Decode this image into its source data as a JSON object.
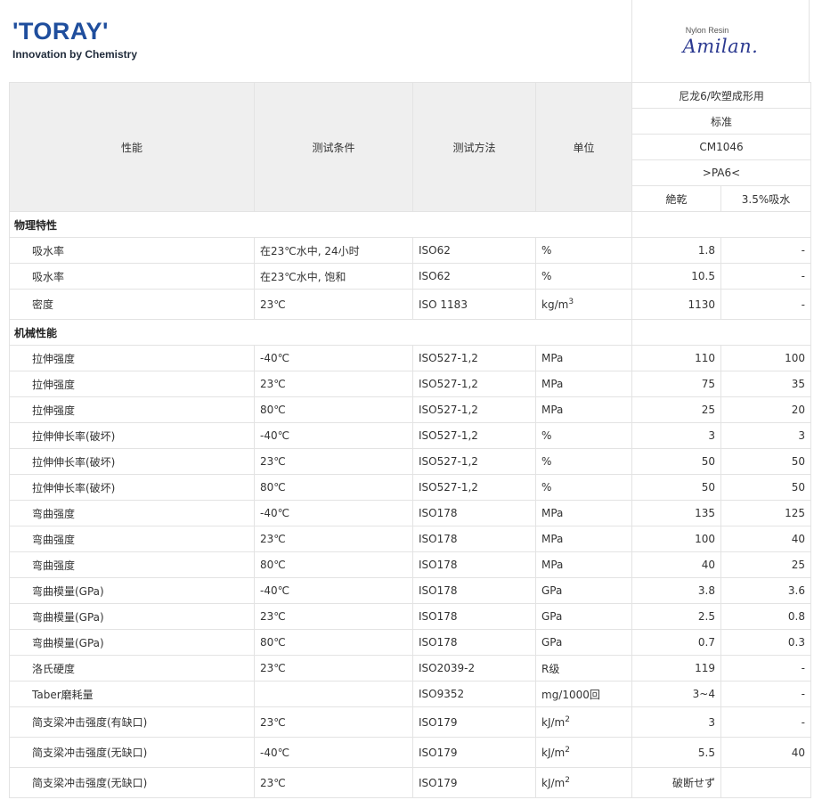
{
  "header": {
    "logo_text": "'TORAY'",
    "tagline": "Innovation by Chemistry",
    "brand_sub": "Nylon Resin",
    "brand_name": "Amilan."
  },
  "table": {
    "columns": {
      "property": "性能",
      "condition": "测试条件",
      "method": "测试方法",
      "unit": "单位"
    },
    "product": {
      "category": "尼龙6/吹塑成形用",
      "grade": "标准",
      "model": "CM1046",
      "marking": ">PA6<",
      "col_dry": "絶乾",
      "col_wet": "3.5%吸水"
    },
    "sections": [
      {
        "title": "物理特性",
        "rows": [
          {
            "prop": "吸水率",
            "cond": "在23℃水中, 24小时",
            "method": "ISO62",
            "unit": "%",
            "dry": "1.8",
            "wet": "-"
          },
          {
            "prop": "吸水率",
            "cond": "在23℃水中, 饱和",
            "method": "ISO62",
            "unit": "%",
            "dry": "10.5",
            "wet": "-"
          },
          {
            "prop": "密度",
            "cond": "23℃",
            "method": "ISO 1183",
            "unit": "kg/m",
            "unit_sup": "3",
            "dry": "1130",
            "wet": "-"
          }
        ]
      },
      {
        "title": "机械性能",
        "rows": [
          {
            "prop": "拉伸强度",
            "cond": "-40℃",
            "method": "ISO527-1,2",
            "unit": "MPa",
            "dry": "110",
            "wet": "100"
          },
          {
            "prop": "拉伸强度",
            "cond": "23℃",
            "method": "ISO527-1,2",
            "unit": "MPa",
            "dry": "75",
            "wet": "35"
          },
          {
            "prop": "拉伸强度",
            "cond": "80℃",
            "method": "ISO527-1,2",
            "unit": "MPa",
            "dry": "25",
            "wet": "20"
          },
          {
            "prop": "拉伸伸长率(破坏)",
            "cond": "-40℃",
            "method": "ISO527-1,2",
            "unit": "%",
            "dry": "3",
            "wet": "3"
          },
          {
            "prop": "拉伸伸长率(破坏)",
            "cond": "23℃",
            "method": "ISO527-1,2",
            "unit": "%",
            "dry": "50",
            "wet": "50"
          },
          {
            "prop": "拉伸伸长率(破坏)",
            "cond": "80℃",
            "method": "ISO527-1,2",
            "unit": "%",
            "dry": "50",
            "wet": "50"
          },
          {
            "prop": "弯曲强度",
            "cond": "-40℃",
            "method": "ISO178",
            "unit": "MPa",
            "dry": "135",
            "wet": "125"
          },
          {
            "prop": "弯曲强度",
            "cond": "23℃",
            "method": "ISO178",
            "unit": "MPa",
            "dry": "100",
            "wet": "40"
          },
          {
            "prop": "弯曲强度",
            "cond": "80℃",
            "method": "ISO178",
            "unit": "MPa",
            "dry": "40",
            "wet": "25"
          },
          {
            "prop": "弯曲模量(GPa)",
            "cond": "-40℃",
            "method": "ISO178",
            "unit": "GPa",
            "dry": "3.8",
            "wet": "3.6"
          },
          {
            "prop": "弯曲模量(GPa)",
            "cond": "23℃",
            "method": "ISO178",
            "unit": "GPa",
            "dry": "2.5",
            "wet": "0.8"
          },
          {
            "prop": "弯曲模量(GPa)",
            "cond": "80℃",
            "method": "ISO178",
            "unit": "GPa",
            "dry": "0.7",
            "wet": "0.3"
          },
          {
            "prop": "洛氏硬度",
            "cond": "23℃",
            "method": "ISO2039-2",
            "unit": "R级",
            "dry": "119",
            "wet": "-"
          },
          {
            "prop": "Taber磨耗量",
            "cond": "",
            "method": "ISO9352",
            "unit": "mg/1000回",
            "dry": "3~4",
            "wet": "-"
          },
          {
            "prop": "简支梁冲击强度(有缺口)",
            "cond": "23℃",
            "method": "ISO179",
            "unit": "kJ/m",
            "unit_sup": "2",
            "dry": "3",
            "wet": "-"
          },
          {
            "prop": "简支梁冲击强度(无缺口)",
            "cond": "-40℃",
            "method": "ISO179",
            "unit": "kJ/m",
            "unit_sup": "2",
            "dry": "5.5",
            "wet": "40"
          },
          {
            "prop": "简支梁冲击强度(无缺口)",
            "cond": "23℃",
            "method": "ISO179",
            "unit": "kJ/m",
            "unit_sup": "2",
            "dry": "破断せず",
            "wet": ""
          }
        ]
      }
    ]
  }
}
